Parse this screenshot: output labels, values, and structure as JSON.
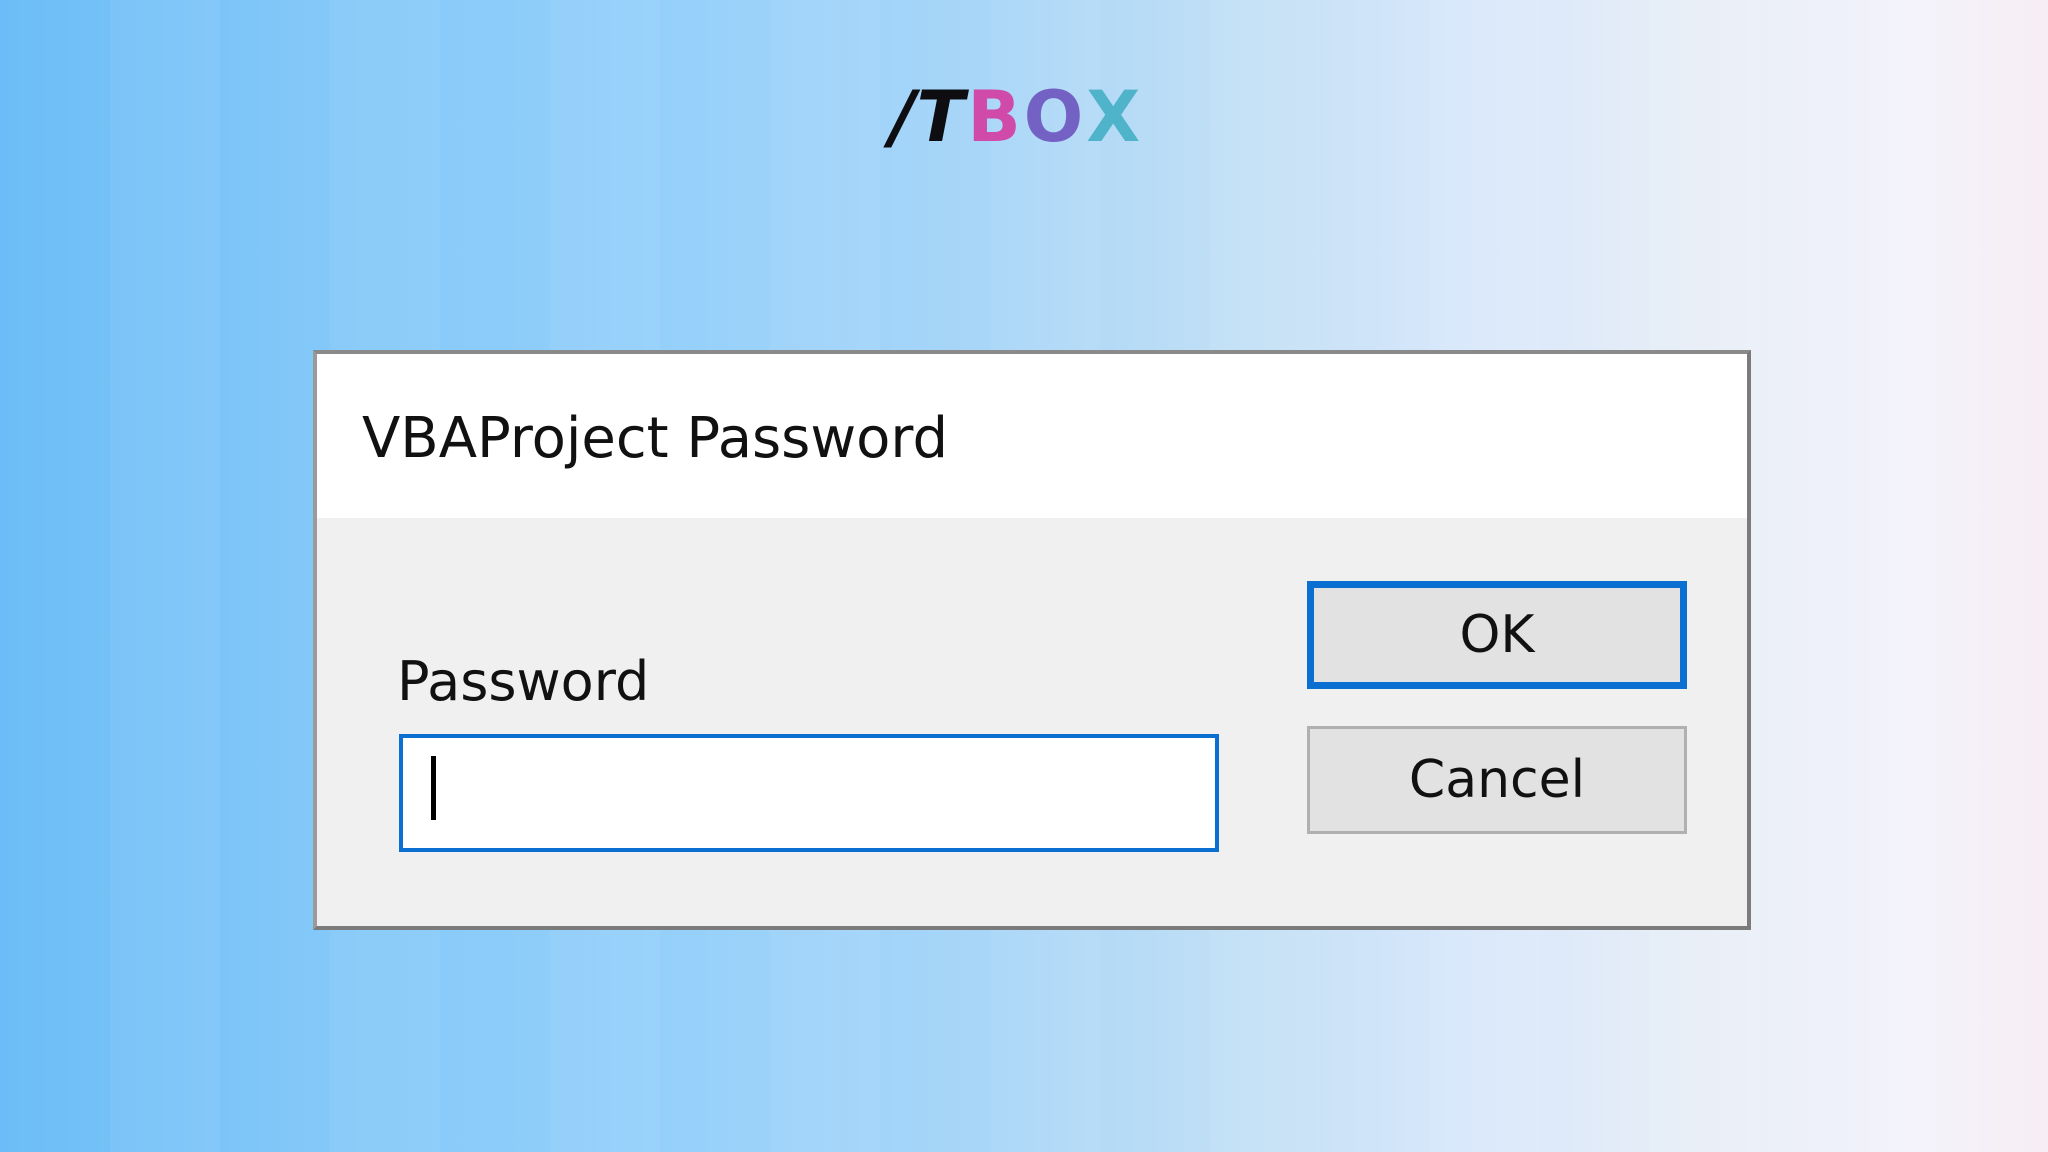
{
  "logo": {
    "part1": "/T",
    "part2": "B",
    "part3": "O",
    "part4": "X",
    "colors": {
      "dark": "#0e0e12",
      "pink": "#cf4aa9",
      "purple": "#7461c4",
      "teal": "#4fb3c9"
    }
  },
  "dialog": {
    "title": "VBAProject Password",
    "password_label": "Password",
    "password_value": "",
    "ok_label": "OK",
    "cancel_label": "Cancel",
    "focus_color": "#0a6fd0"
  }
}
